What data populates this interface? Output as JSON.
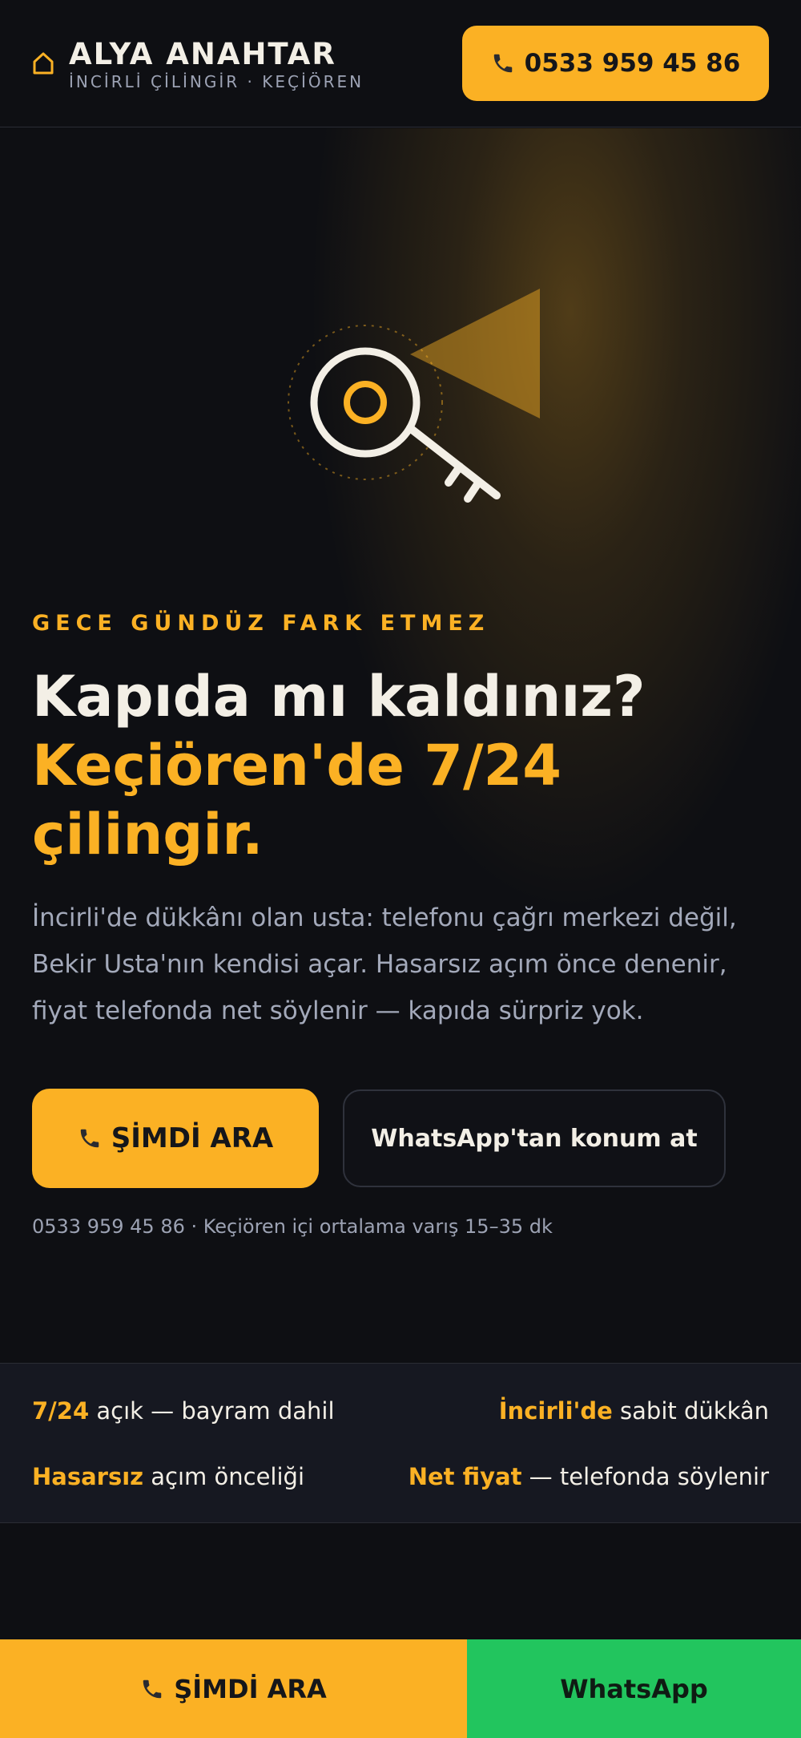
{
  "header": {
    "brand_name": "ALYA ANAHTAR",
    "brand_sub": "İNCİRLİ ÇİLİNGİR · KEÇİÖREN",
    "phone": "0533 959 45 86",
    "home_icon": "home-icon",
    "phone_icon": "phone-icon"
  },
  "hero": {
    "eyebrow": "GECE GÜNDÜZ FARK ETMEZ",
    "headline_line1": "Kapıda mı kaldınız?",
    "headline_line2": "Keçiören'de 7/24",
    "headline_line3": "çilingir.",
    "lead": "İncirli'de dükkânı olan usta: telefonu çağrı merkezi değil, Bekir Usta'nın kendisi açar. Hasarsız açım önce denenir, fiyat telefonda net söylenir — kapıda sürpriz yok.",
    "call_button": "ŞİMDİ ARA",
    "whatsapp_button": "WhatsApp'tan konum at",
    "note": "0533 959 45 86 · Keçiören içi ortalama varış 15–35 dk",
    "art_icon": "key-icon"
  },
  "features": [
    {
      "strong": "7/24",
      "text": " açık — bayram dahil"
    },
    {
      "strong": "İncirli'de",
      "text": " sabit dükkân"
    },
    {
      "strong": "Hasarsız",
      "text": " açım önceliği"
    },
    {
      "strong": "Net fiyat",
      "text": " — telefonda söylenir"
    }
  ],
  "bottom_bar": {
    "call": "ŞİMDİ ARA",
    "whatsapp": "WhatsApp"
  },
  "colors": {
    "accent": "#fbb124",
    "background": "#0e0f13",
    "whatsapp": "#22c55e"
  }
}
